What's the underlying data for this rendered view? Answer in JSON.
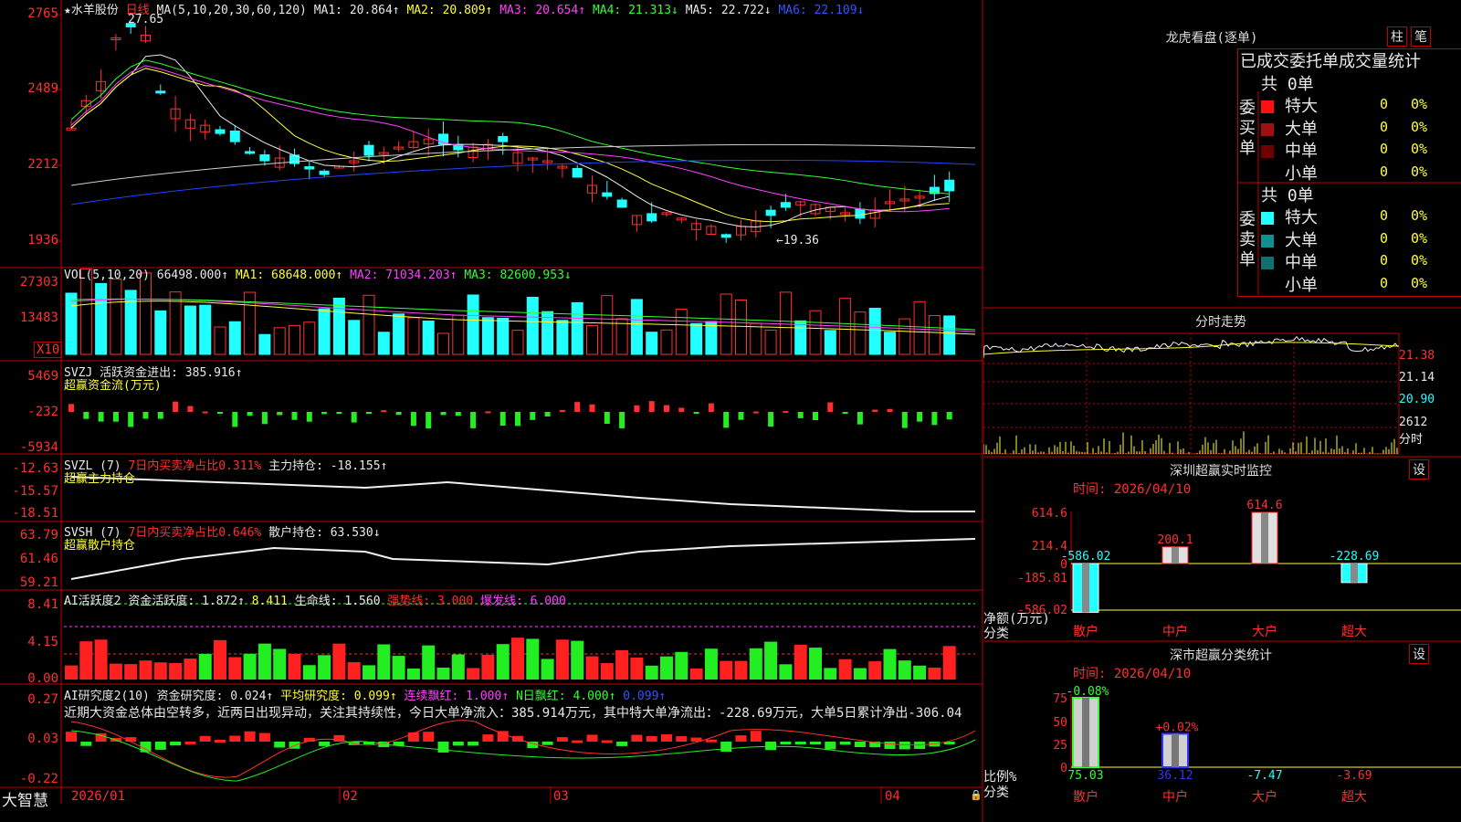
{
  "header": {
    "stock": "★水羊股份",
    "period": "日线",
    "ma_label": "MA(5,10,20,30,60,120)",
    "ma": [
      {
        "label": "MA1: 20.864↑",
        "color": "#e8e8e8"
      },
      {
        "label": "MA2: 20.809↑",
        "color": "#ffff33"
      },
      {
        "label": "MA3: 20.654↑",
        "color": "#ff40ff"
      },
      {
        "label": "MA4: 21.313↓",
        "color": "#33ff33"
      },
      {
        "label": "MA5: 22.722↓",
        "color": "#e8e8e8"
      },
      {
        "label": "MA6: 22.109↓",
        "color": "#3355ff"
      }
    ],
    "high_mark": "27.65",
    "low_mark": "←19.36"
  },
  "price_axis": [
    "2765",
    "2489",
    "2212",
    "1936"
  ],
  "vol": {
    "title": "VOL(5,10,20)",
    "value": "66498.000↑",
    "ma": [
      {
        "label": "MA1: 68648.000↑",
        "color": "#ffff33"
      },
      {
        "label": "MA2: 71034.203↑",
        "color": "#ff40ff"
      },
      {
        "label": "MA3: 82600.953↓",
        "color": "#33ff33"
      }
    ],
    "axis": [
      "27303",
      "13483"
    ],
    "unit": "X10"
  },
  "svzj": {
    "title": "SVZJ  活跃资金进出: 385.916↑",
    "subtitle": "超赢资金流(万元)",
    "axis": [
      "5469",
      "-232",
      "-5934"
    ]
  },
  "svzl": {
    "title": "SVZL (7)",
    "t2": "7日内买卖净占比0.311%",
    "t3": "主力持仓: -18.155↑",
    "subtitle": "超赢主力持仓",
    "axis": [
      "-12.63",
      "-15.57",
      "-18.51"
    ]
  },
  "svsh": {
    "title": "SVSH (7)",
    "t2": "7日内买卖净占比0.646%",
    "t3": "散户持仓: 63.530↓",
    "subtitle": "超赢散户持仓",
    "axis": [
      "63.79",
      "61.46",
      "59.21"
    ]
  },
  "ai1": {
    "title": "AI活跃度2",
    "parts": [
      {
        "label": "资金活跃度: 1.872↑",
        "color": "#e8e8e8"
      },
      {
        "label": "8.411",
        "color": "#ffff33"
      },
      {
        "label": "生命线: 1.560",
        "color": "#e8e8e8"
      },
      {
        "label": "强势线: 3.000",
        "color": "#ff3030"
      },
      {
        "label": "爆发线: 6.000",
        "color": "#ff40ff"
      }
    ],
    "axis": [
      "8.41",
      "4.15",
      "0.00"
    ]
  },
  "ai2": {
    "title": "AI研究度2(10)",
    "parts": [
      {
        "label": "资金研究度: 0.024↑",
        "color": "#e8e8e8"
      },
      {
        "label": "平均研究度: 0.099↑",
        "color": "#ffff33"
      },
      {
        "label": "连续飘红: 1.000↑",
        "color": "#ff40ff"
      },
      {
        "label": "N日飘红: 4.000↑",
        "color": "#33ff33"
      },
      {
        "label": "0.099↑",
        "color": "#3355ff"
      }
    ],
    "commentary": "近期大资金总体由空转多，近两日出现异动，关注其持续性，今日大单净流入：385.914万元，其中特大单净流出：-228.69万元，大单5日累计净出-306.04",
    "axis": [
      "0.27",
      "0.03",
      "-0.22"
    ]
  },
  "dates": [
    "2026/01",
    "02",
    "03",
    "04"
  ],
  "logo": "大智慧",
  "right": {
    "longhu_title": "龙虎看盘(逐单)",
    "btn_zhu": "柱",
    "btn_bi": "笔",
    "tbl_title": "已成交委托单成交量统计",
    "buy_label": "委买单",
    "sell_label": "委卖单",
    "buy_total": "共 0单",
    "sell_total": "共 0单",
    "buy_rows": [
      {
        "name": "特大",
        "count": "0",
        "pct": "0%",
        "color": "#ff1010"
      },
      {
        "name": "大单",
        "count": "0",
        "pct": "0%",
        "color": "#a01010"
      },
      {
        "name": "中单",
        "count": "0",
        "pct": "0%",
        "color": "#700000"
      },
      {
        "name": "小单",
        "count": "0",
        "pct": "0%",
        "color": "#000000"
      }
    ],
    "sell_rows": [
      {
        "name": "特大",
        "count": "0",
        "pct": "0%",
        "color": "#22ffff"
      },
      {
        "name": "大单",
        "count": "0",
        "pct": "0%",
        "color": "#109090"
      },
      {
        "name": "中单",
        "count": "0",
        "pct": "0%",
        "color": "#107070"
      },
      {
        "name": "小单",
        "count": "0",
        "pct": "0%",
        "color": "#000000"
      }
    ],
    "intraday_title": "分时走势",
    "intraday_axis": [
      "21.38",
      "21.14",
      "20.90"
    ],
    "intraday_vol": "2612",
    "intraday_time": "分时",
    "sz_title": "深圳超赢实时监控",
    "sz_set": "设",
    "sz_time": "时间: 2026/04/10",
    "sz_axis": [
      "614.6",
      "214.4",
      "0",
      "-185.81",
      "-586.02"
    ],
    "sz_ylabel": "净额(万元)",
    "sz_xlabel": "分类",
    "sz_bars": [
      {
        "label": "散户",
        "value": -586.02,
        "text": "-586.02"
      },
      {
        "label": "中户",
        "value": 200.1,
        "text": "200.1"
      },
      {
        "label": "大户",
        "value": 614.6,
        "text": "614.6"
      },
      {
        "label": "超大",
        "value": -228.69,
        "text": "-228.69"
      }
    ],
    "cls_title": "深市超赢分类统计",
    "cls_set": "设",
    "cls_time": "时间: 2026/04/10",
    "cls_axis": [
      "75",
      "50",
      "25",
      "0"
    ],
    "cls_ylabel": "比例%",
    "cls_xlabel": "分类",
    "cls_bars": [
      {
        "label": "散户",
        "value": 75.03,
        "top": "-0.08%",
        "bottom": "75.03"
      },
      {
        "label": "中户",
        "value": 36.12,
        "top": "+0.02%",
        "bottom": "36.12"
      },
      {
        "label": "大户",
        "value": -7.47,
        "top": "",
        "bottom": "-7.47"
      },
      {
        "label": "超大",
        "value": -3.69,
        "top": "",
        "bottom": "-3.69"
      }
    ]
  },
  "colors": {
    "up": "#ff3030",
    "down": "#22ffff",
    "frame": "#c00000"
  }
}
